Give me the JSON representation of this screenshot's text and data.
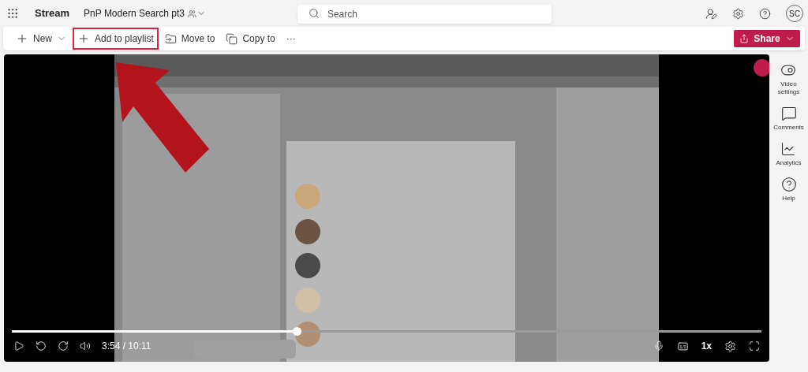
{
  "header": {
    "app_name": "Stream",
    "file_name": "PnP Modern Search pt3",
    "search": {
      "placeholder": "Search"
    },
    "avatar": "SC"
  },
  "toolbar": {
    "items": [
      {
        "kind": "new",
        "label": "New",
        "highlighted": false
      },
      {
        "kind": "add",
        "label": "Add to playlist",
        "highlighted": true
      },
      {
        "kind": "move",
        "label": "Move to",
        "highlighted": false
      },
      {
        "kind": "copy",
        "label": "Copy to",
        "highlighted": false
      },
      {
        "kind": "more",
        "label": "···",
        "highlighted": false
      }
    ],
    "share": "Share"
  },
  "player": {
    "progress": {
      "level": 0.38
    },
    "time": "3:54 / 10:11",
    "speed": "1x"
  },
  "rail": [
    {
      "kind": "settings",
      "label": "Video\nsettings"
    },
    {
      "kind": "comments",
      "label": "Comments"
    },
    {
      "kind": "analytics",
      "label": "Analytics"
    },
    {
      "kind": "help",
      "label": "Help"
    }
  ]
}
